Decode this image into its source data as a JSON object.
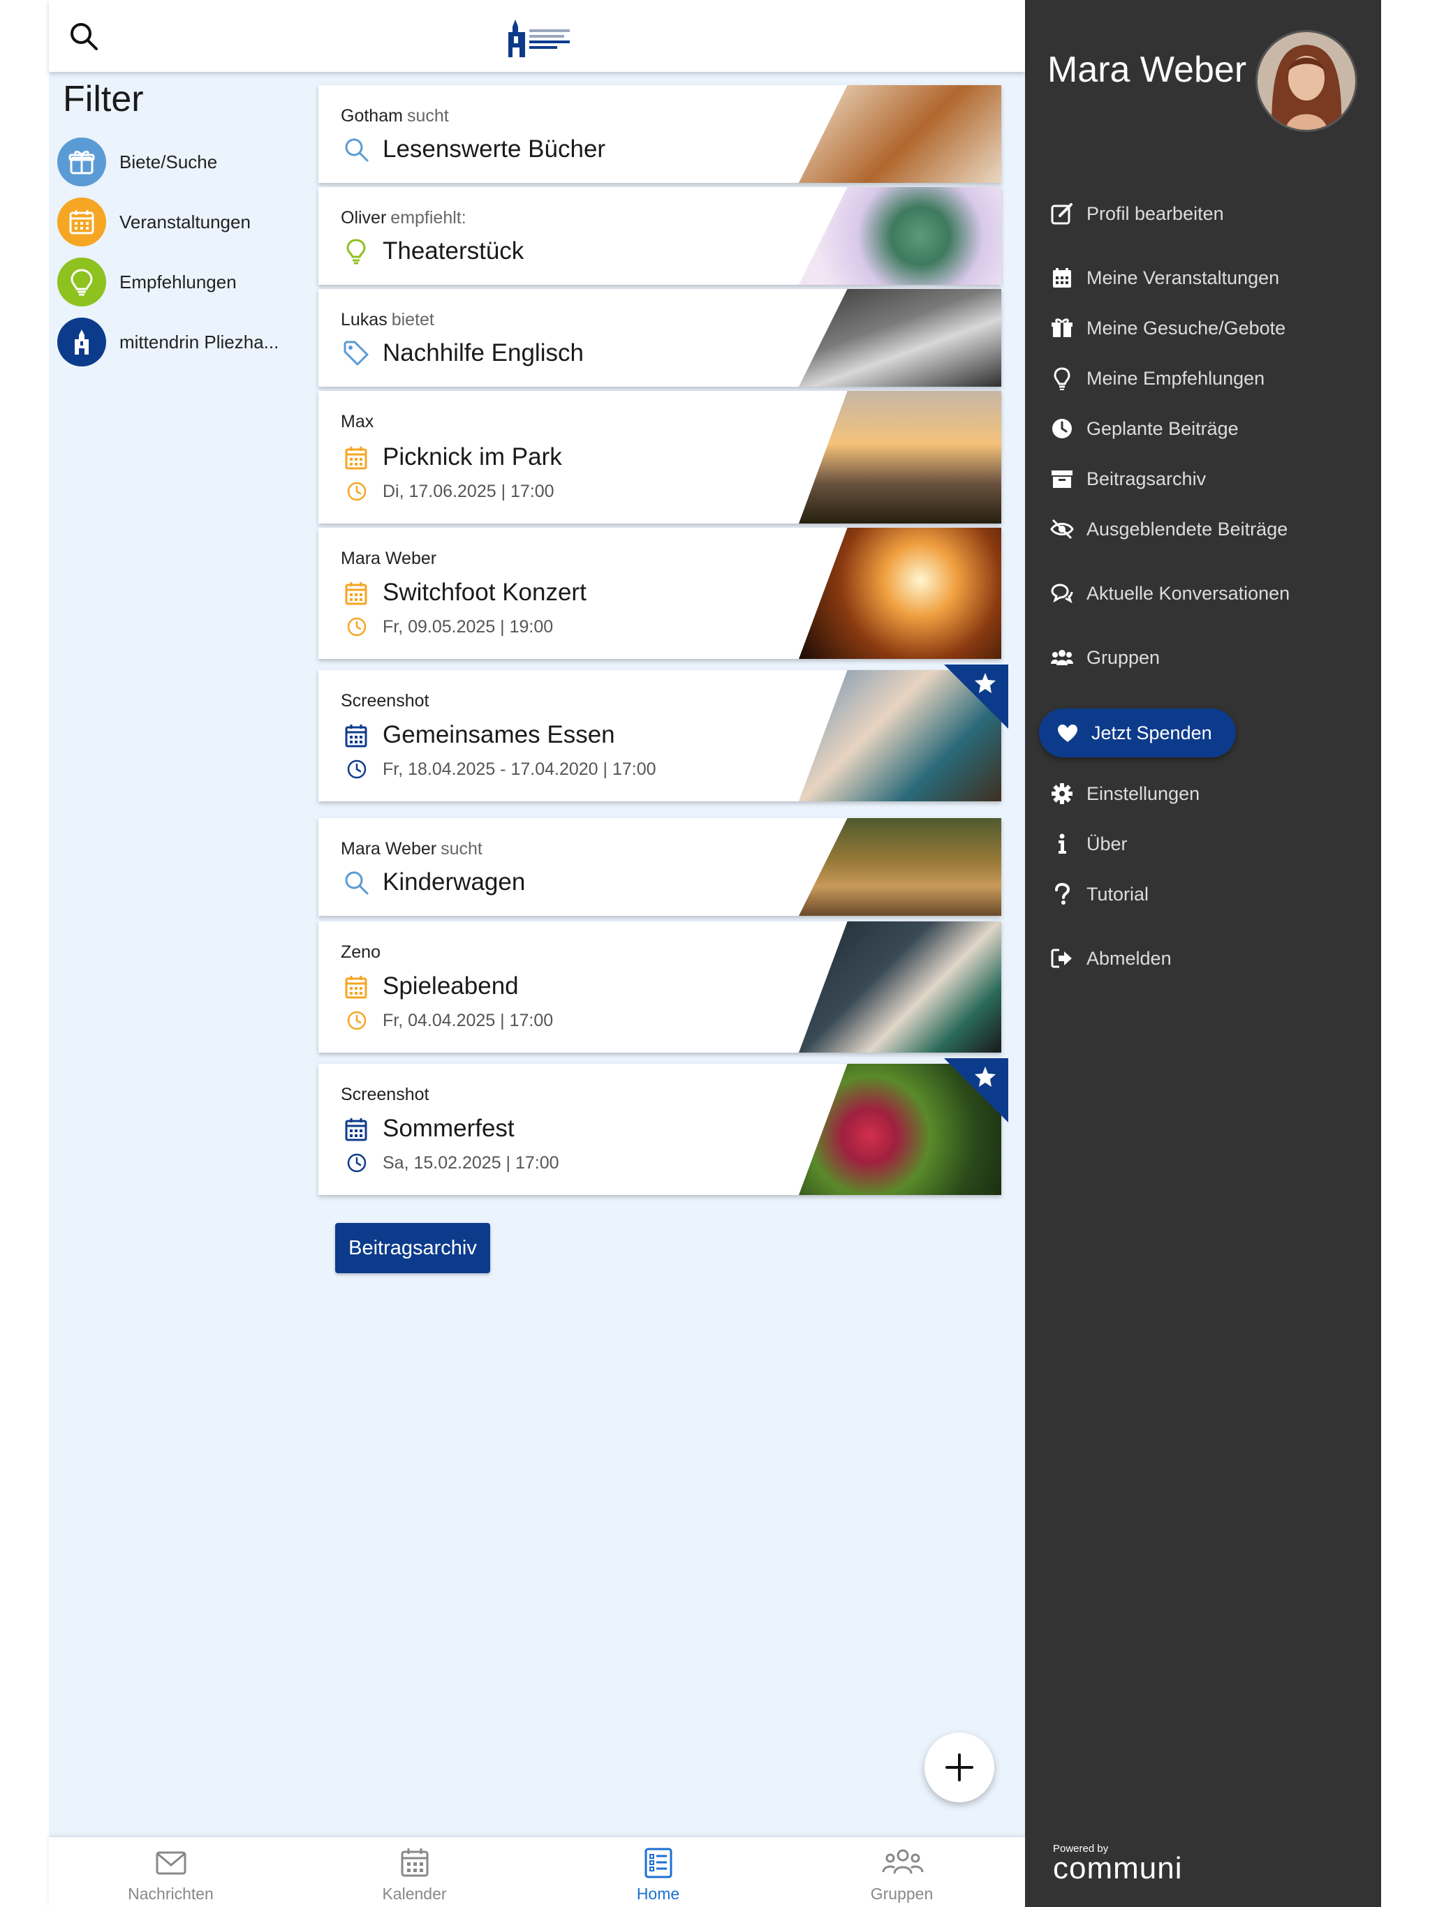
{
  "filter": {
    "title": "Filter",
    "items": [
      {
        "label": "Biete/Suche",
        "icon": "gift-icon",
        "color": "#5b9bd5"
      },
      {
        "label": "Veranstaltungen",
        "icon": "calendar-icon",
        "color": "#f5a623"
      },
      {
        "label": "Empfehlungen",
        "icon": "lightbulb-icon",
        "color": "#8dc21f"
      },
      {
        "label": "mittendrin Pliezha...",
        "icon": "church-icon",
        "color": "#0d3b8c"
      }
    ]
  },
  "feed": [
    {
      "author": "Gotham",
      "verb": "sucht",
      "title": "Lesenswerte Bücher",
      "type": "search"
    },
    {
      "author": "Oliver",
      "verb": "empfiehlt:",
      "title": "Theaterstück",
      "type": "recommendation"
    },
    {
      "author": "Lukas",
      "verb": "bietet",
      "title": "Nachhilfe Englisch",
      "type": "offer"
    },
    {
      "author": "Max",
      "verb": "",
      "title": "Picknick im Park",
      "type": "event",
      "date": "Di, 17.06.2025 | 17:00"
    },
    {
      "author": "Mara Weber",
      "verb": "",
      "title": "Switchfoot Konzert",
      "type": "event",
      "date": "Fr, 09.05.2025 | 19:00"
    },
    {
      "author": "Screenshot",
      "verb": "",
      "title": "Gemeinsames Essen",
      "type": "group-event",
      "date": "Fr, 18.04.2025 - 17.04.2020 | 17:00",
      "starred": true
    },
    {
      "author": "Mara Weber",
      "verb": "sucht",
      "title": "Kinderwagen",
      "type": "search"
    },
    {
      "author": "Zeno",
      "verb": "",
      "title": "Spieleabend",
      "type": "event",
      "date": "Fr, 04.04.2025 | 17:00"
    },
    {
      "author": "Screenshot",
      "verb": "",
      "title": "Sommerfest",
      "type": "group-event",
      "date": "Sa, 15.02.2025 | 17:00",
      "starred": true
    }
  ],
  "archive_button": "Beitragsarchiv",
  "bottom_nav": [
    {
      "label": "Nachrichten",
      "icon": "mail-icon"
    },
    {
      "label": "Kalender",
      "icon": "calendar-icon"
    },
    {
      "label": "Home",
      "icon": "list-icon",
      "active": true
    },
    {
      "label": "Gruppen",
      "icon": "users-icon"
    }
  ],
  "drawer": {
    "user_name": "Mara Weber",
    "menu": [
      {
        "label": "Profil bearbeiten",
        "icon": "edit-icon"
      },
      {
        "label": "Meine Veranstaltungen",
        "icon": "calendar-icon"
      },
      {
        "label": "Meine Gesuche/Gebote",
        "icon": "gift-icon"
      },
      {
        "label": "Meine Empfehlungen",
        "icon": "lightbulb-icon"
      },
      {
        "label": "Geplante Beiträge",
        "icon": "clock-icon"
      },
      {
        "label": "Beitragsarchiv",
        "icon": "archive-icon"
      },
      {
        "label": "Ausgeblendete Beiträge",
        "icon": "eye-slash-icon"
      },
      {
        "label": "Aktuelle Konversationen",
        "icon": "chat-icon"
      },
      {
        "label": "Gruppen",
        "icon": "users-icon"
      },
      {
        "label": "Einstellungen",
        "icon": "gear-icon"
      },
      {
        "label": "Über",
        "icon": "info-icon"
      },
      {
        "label": "Tutorial",
        "icon": "question-icon"
      },
      {
        "label": "Abmelden",
        "icon": "logout-icon"
      }
    ],
    "donate": "Jetzt Spenden",
    "powered_by": "Powered by",
    "brand": "communi"
  },
  "colors": {
    "primary": "#0d3b8c",
    "event": "#f5a623",
    "search": "#5b9bd5",
    "recommendation": "#8dc21f",
    "drawer_bg": "#333333",
    "feed_bg": "#ebf3fd"
  }
}
